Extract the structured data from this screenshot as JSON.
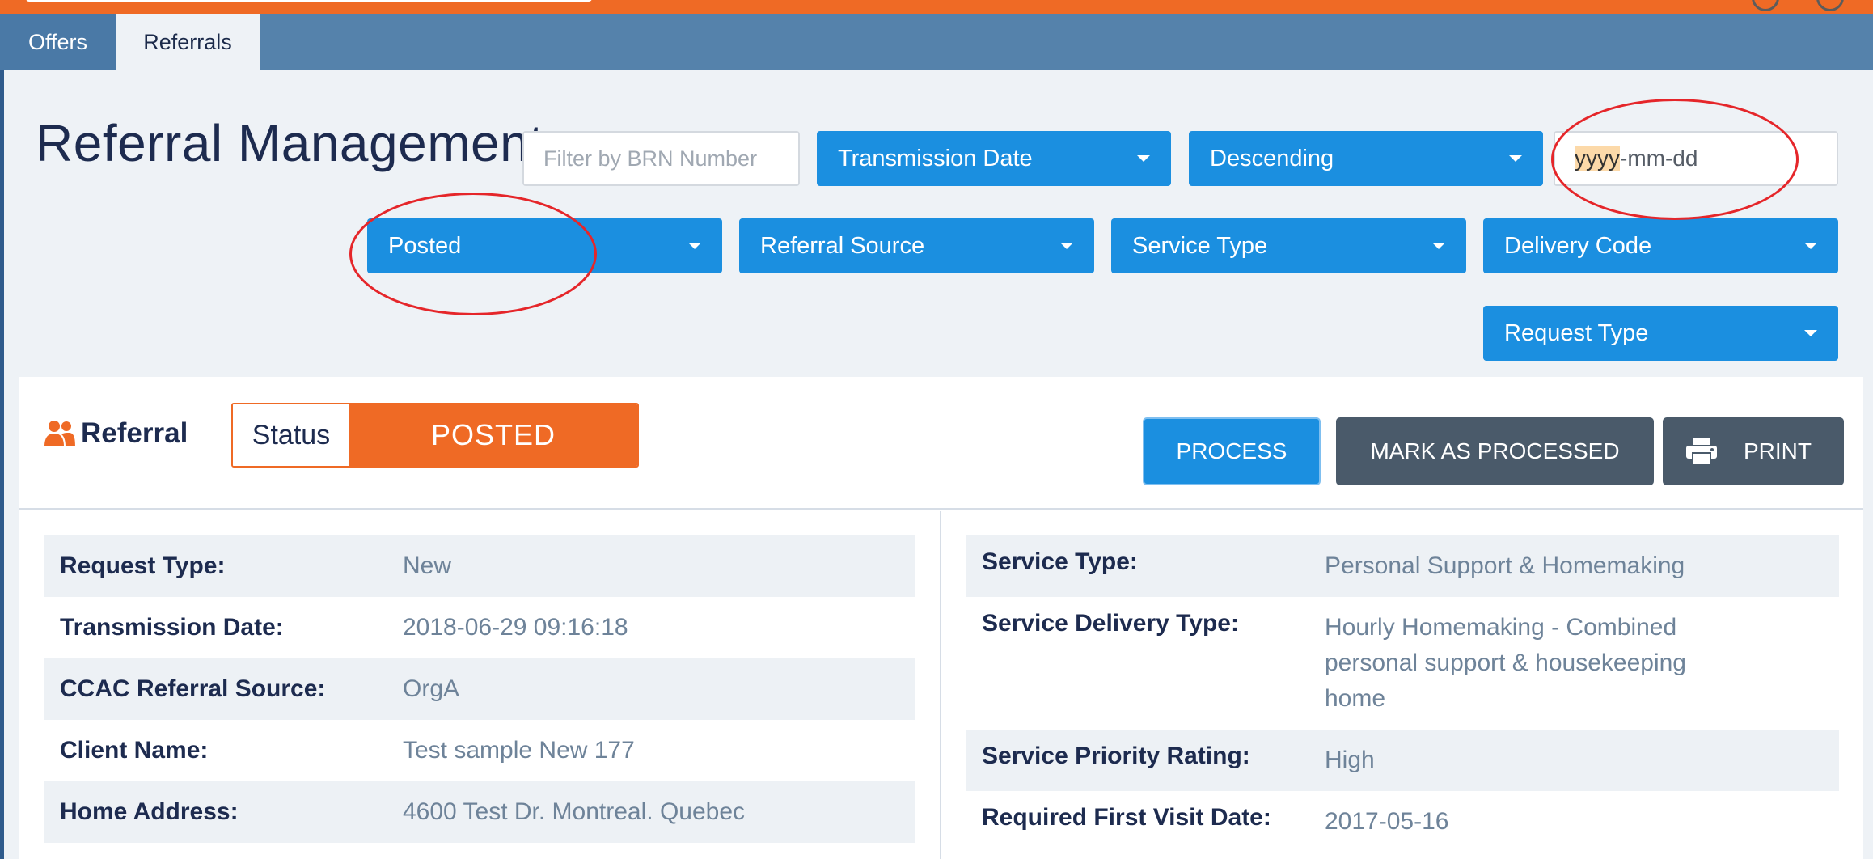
{
  "tabs": {
    "offers": "Offers",
    "referrals": "Referrals"
  },
  "page_title": "Referral Management",
  "filters": {
    "brn_placeholder": "Filter by BRN Number",
    "sort_field": "Transmission Date",
    "sort_order": "Descending",
    "date_placeholder_year": "yyyy",
    "date_placeholder_rest": "-mm-dd",
    "status": "Posted",
    "referral_source": "Referral Source",
    "service_type": "Service Type",
    "delivery_code": "Delivery Code",
    "request_type": "Request Type"
  },
  "referral": {
    "title": "Referral",
    "status_label": "Status",
    "status_value": "POSTED",
    "actions": {
      "process": "PROCESS",
      "mark": "MARK AS PROCESSED",
      "print": "PRINT"
    }
  },
  "left_details": [
    {
      "label": "Request Type:",
      "value": "New"
    },
    {
      "label": "Transmission Date:",
      "value": "2018-06-29 09:16:18"
    },
    {
      "label": "CCAC Referral Source:",
      "value": "OrgA"
    },
    {
      "label": "Client Name:",
      "value": "Test sample New 177"
    },
    {
      "label": "Home Address:",
      "value": "4600 Test Dr. Montreal. Quebec"
    }
  ],
  "right_details": [
    {
      "label": "Service Type:",
      "value": "Personal Support & Homemaking"
    },
    {
      "label": "Service Delivery Type:",
      "value": "Hourly Homemaking - Combined personal support & housekeeping home"
    },
    {
      "label": "Service Priority Rating:",
      "value": "High"
    },
    {
      "label": "Required First Visit Date:",
      "value": "2017-05-16"
    }
  ],
  "colors": {
    "brand_orange": "#ef6a25",
    "tab_blue": "#5582ab",
    "action_blue": "#1b8fe0",
    "dark_button": "#4a5a6a",
    "annotation_red": "#e5262a"
  }
}
